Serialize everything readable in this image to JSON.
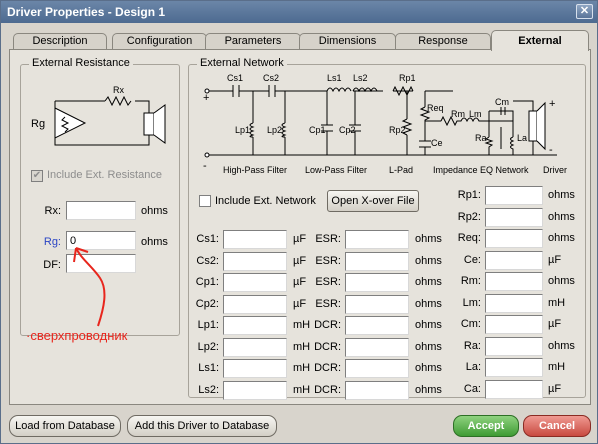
{
  "window": {
    "title": "Driver Properties - Design 1",
    "close": "✕"
  },
  "tabs": [
    {
      "label": "Description",
      "active": false
    },
    {
      "label": "Configuration",
      "active": false
    },
    {
      "label": "Parameters",
      "active": false
    },
    {
      "label": "Dimensions",
      "active": false
    },
    {
      "label": "Response",
      "active": false
    },
    {
      "label": "External",
      "active": true
    }
  ],
  "external_resistance": {
    "title": "External Resistance",
    "diagram": {
      "rx": "Rx",
      "rg": "Rg"
    },
    "include_label": "Include Ext. Resistance",
    "include_checked": true,
    "rx": {
      "label": "Rx:",
      "value": "",
      "unit": "ohms"
    },
    "rg": {
      "label": "Rg:",
      "value": "0",
      "unit": "ohms"
    },
    "df": {
      "label": "DF:",
      "value": ""
    }
  },
  "external_network": {
    "title": "External Network",
    "diagram": {
      "cs1": "Cs1",
      "cs2": "Cs2",
      "ls1": "Ls1",
      "ls2": "Ls2",
      "rp1": "Rp1",
      "lp1": "Lp1",
      "lp2": "Lp2",
      "cp1": "Cp1",
      "cp2": "Cp2",
      "rp2": "Rp2",
      "req": "Req",
      "rm": "Rm",
      "lm": "Lm",
      "cm": "Cm",
      "ce": "Ce",
      "ra": "Ra",
      "la": "La",
      "plus": "+",
      "minus": "-",
      "hpf": "High-Pass Filter",
      "lpf": "Low-Pass Filter",
      "lpad": "L-Pad",
      "imp": "Impedance EQ Network",
      "driver": "Driver"
    },
    "include_label": "Include Ext. Network",
    "open_xover": "Open X-over File",
    "left_fields": [
      {
        "label": "Cs1:",
        "unit": "µF",
        "rlabel": "ESR:",
        "runit": "ohms"
      },
      {
        "label": "Cs2:",
        "unit": "µF",
        "rlabel": "ESR:",
        "runit": "ohms"
      },
      {
        "label": "Cp1:",
        "unit": "µF",
        "rlabel": "ESR:",
        "runit": "ohms"
      },
      {
        "label": "Cp2:",
        "unit": "µF",
        "rlabel": "ESR:",
        "runit": "ohms"
      },
      {
        "label": "Lp1:",
        "unit": "mH",
        "rlabel": "DCR:",
        "runit": "ohms"
      },
      {
        "label": "Lp2:",
        "unit": "mH",
        "rlabel": "DCR:",
        "runit": "ohms"
      },
      {
        "label": "Ls1:",
        "unit": "mH",
        "rlabel": "DCR:",
        "runit": "ohms"
      },
      {
        "label": "Ls2:",
        "unit": "mH",
        "rlabel": "DCR:",
        "runit": "ohms"
      }
    ],
    "right_fields": [
      {
        "label": "Rp1:",
        "unit": "ohms"
      },
      {
        "label": "Rp2:",
        "unit": "ohms"
      },
      {
        "label": "Req:",
        "unit": "ohms"
      },
      {
        "label": "Ce:",
        "unit": "µF"
      },
      {
        "label": "Rm:",
        "unit": "ohms"
      },
      {
        "label": "Lm:",
        "unit": "mH"
      },
      {
        "label": "Cm:",
        "unit": "µF"
      },
      {
        "label": "Ra:",
        "unit": "ohms"
      },
      {
        "label": "La:",
        "unit": "mH"
      },
      {
        "label": "Ca:",
        "unit": "µF"
      }
    ]
  },
  "annotation": {
    "text": "·сверхпроводник",
    "color": "#e8261d"
  },
  "footer": {
    "load": "Load from Database",
    "add": "Add this Driver to Database",
    "accept": "Accept",
    "cancel": "Cancel"
  }
}
